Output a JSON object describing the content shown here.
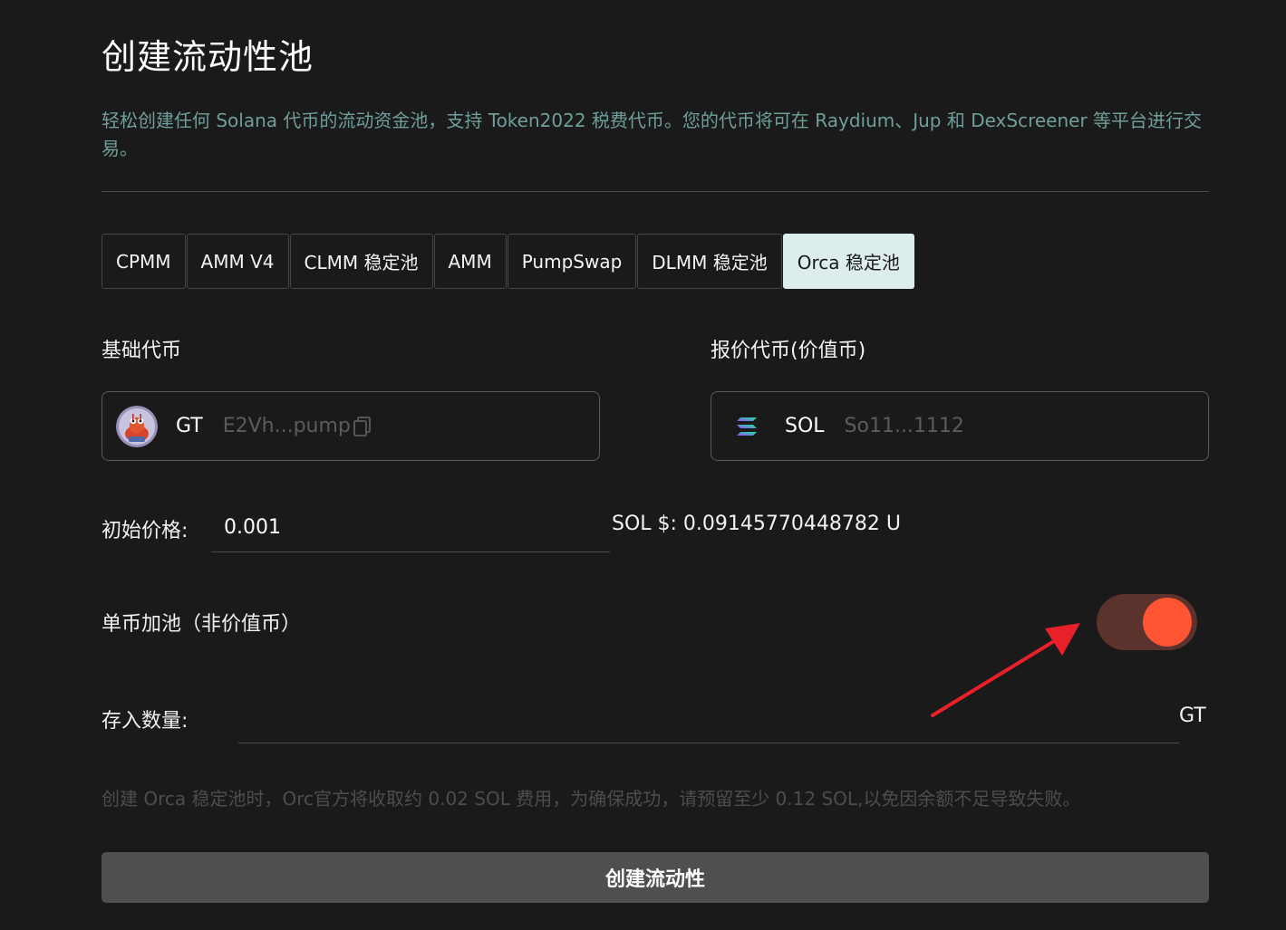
{
  "page": {
    "title": "创建流动性池",
    "description": "轻松创建任何 Solana 代币的流动资金池，支持 Token2022 税费代币。您的代币将可在 Raydium、Jup 和 DexScreener 等平台进行交易。"
  },
  "tabs": [
    {
      "label": "CPMM",
      "active": false
    },
    {
      "label": "AMM V4",
      "active": false
    },
    {
      "label": "CLMM 稳定池",
      "active": false
    },
    {
      "label": "AMM",
      "active": false
    },
    {
      "label": "PumpSwap",
      "active": false
    },
    {
      "label": "DLMM 稳定池",
      "active": false
    },
    {
      "label": "Orca 稳定池",
      "active": true
    }
  ],
  "base_token": {
    "label": "基础代币",
    "symbol": "GT",
    "address": "E2Vh...pump",
    "icon": "token-avatar-icon"
  },
  "quote_token": {
    "label": "报价代币(价值币)",
    "symbol": "SOL",
    "address": "So11...1112",
    "icon": "solana-logo-icon"
  },
  "price": {
    "label": "初始价格:",
    "value": "0.001",
    "usd_text": "SOL  $:  0.09145770448782 U"
  },
  "single_side": {
    "label": "单币加池（非价值币）",
    "enabled": true,
    "on_color": "#ff5533",
    "track_color": "#5b322c"
  },
  "deposit": {
    "label": "存入数量:",
    "value": "",
    "unit": "GT"
  },
  "note": "创建 Orca 稳定池时，Orc官方将收取约 0.02 SOL 费用，为确保成功，请预留至少 0.12 SOL,以免因余额不足导致失败。",
  "submit": {
    "label": "创建流动性"
  },
  "colors": {
    "background": "#1a1a1a",
    "accent_text": "#6f9e9b",
    "active_tab": "#dcedec",
    "annotation_arrow": "#e8202a"
  }
}
